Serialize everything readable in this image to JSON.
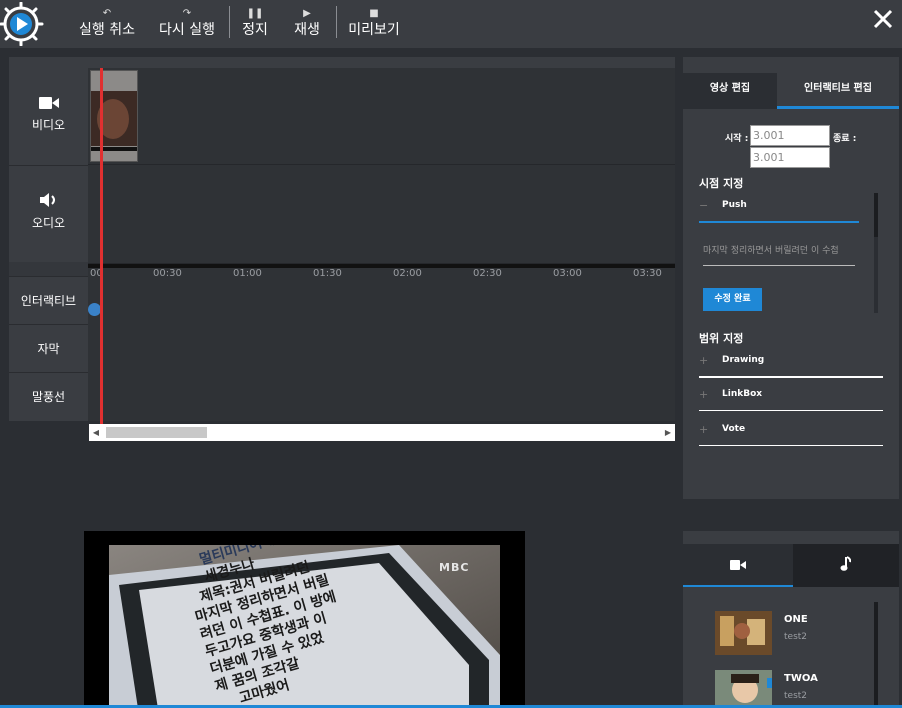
{
  "toolbar": {
    "undo_label": "실행 취소",
    "redo_label": "다시 실행",
    "stop_label": "정지",
    "play_label": "재생",
    "preview_label": "미리보기"
  },
  "timeline": {
    "tracks": {
      "video": "비디오",
      "audio": "오디오",
      "interactive": "인터랙티브",
      "subtitle": "자막",
      "speech_bubble": "말풍선"
    },
    "ruler_ticks": [
      "00",
      "00:30",
      "01:00",
      "01:30",
      "02:00",
      "02:30",
      "03:00",
      "03:30"
    ]
  },
  "edit_panel": {
    "tabs": {
      "video_edit": "영상 편집",
      "interactive_edit": "인터랙티브 편집"
    },
    "start_label": "시작 :",
    "start_value": "3.001",
    "end_label": "종료 :",
    "end_value": "3.001",
    "viewpoint_title": "시점 지정",
    "viewpoint_option": {
      "sign": "−",
      "name": "Push"
    },
    "text_value": "마지막 정리하면서 버릴려던 이 수첩",
    "apply_button": "수정 완료",
    "range_title": "범위 지정",
    "range_options": [
      {
        "sign": "+",
        "name": "Drawing"
      },
      {
        "sign": "+",
        "name": "LinkBox"
      },
      {
        "sign": "+",
        "name": "Vote"
      }
    ]
  },
  "preview": {
    "watermark": "MBC",
    "phone_lines": [
      "멀티미디어메",
      "세경누나",
      "제목:권서 버릴려던",
      "마지막 정리하면서 버릴",
      "려던 이 수첩표. 이 방에",
      "두고가요 중학생과 이",
      "더분에 가질 수 있었",
      "제 꿈의 조각갈",
      "고마웠어"
    ]
  },
  "media": {
    "items": [
      {
        "title": "ONE",
        "sub": "test2"
      },
      {
        "title": "TWOA",
        "sub": "test2"
      }
    ]
  },
  "colors": {
    "accent": "#1f88d6",
    "playhead": "#e03030",
    "toolbar_bg": "#3a3d42",
    "page_bg": "#2b2e33"
  }
}
